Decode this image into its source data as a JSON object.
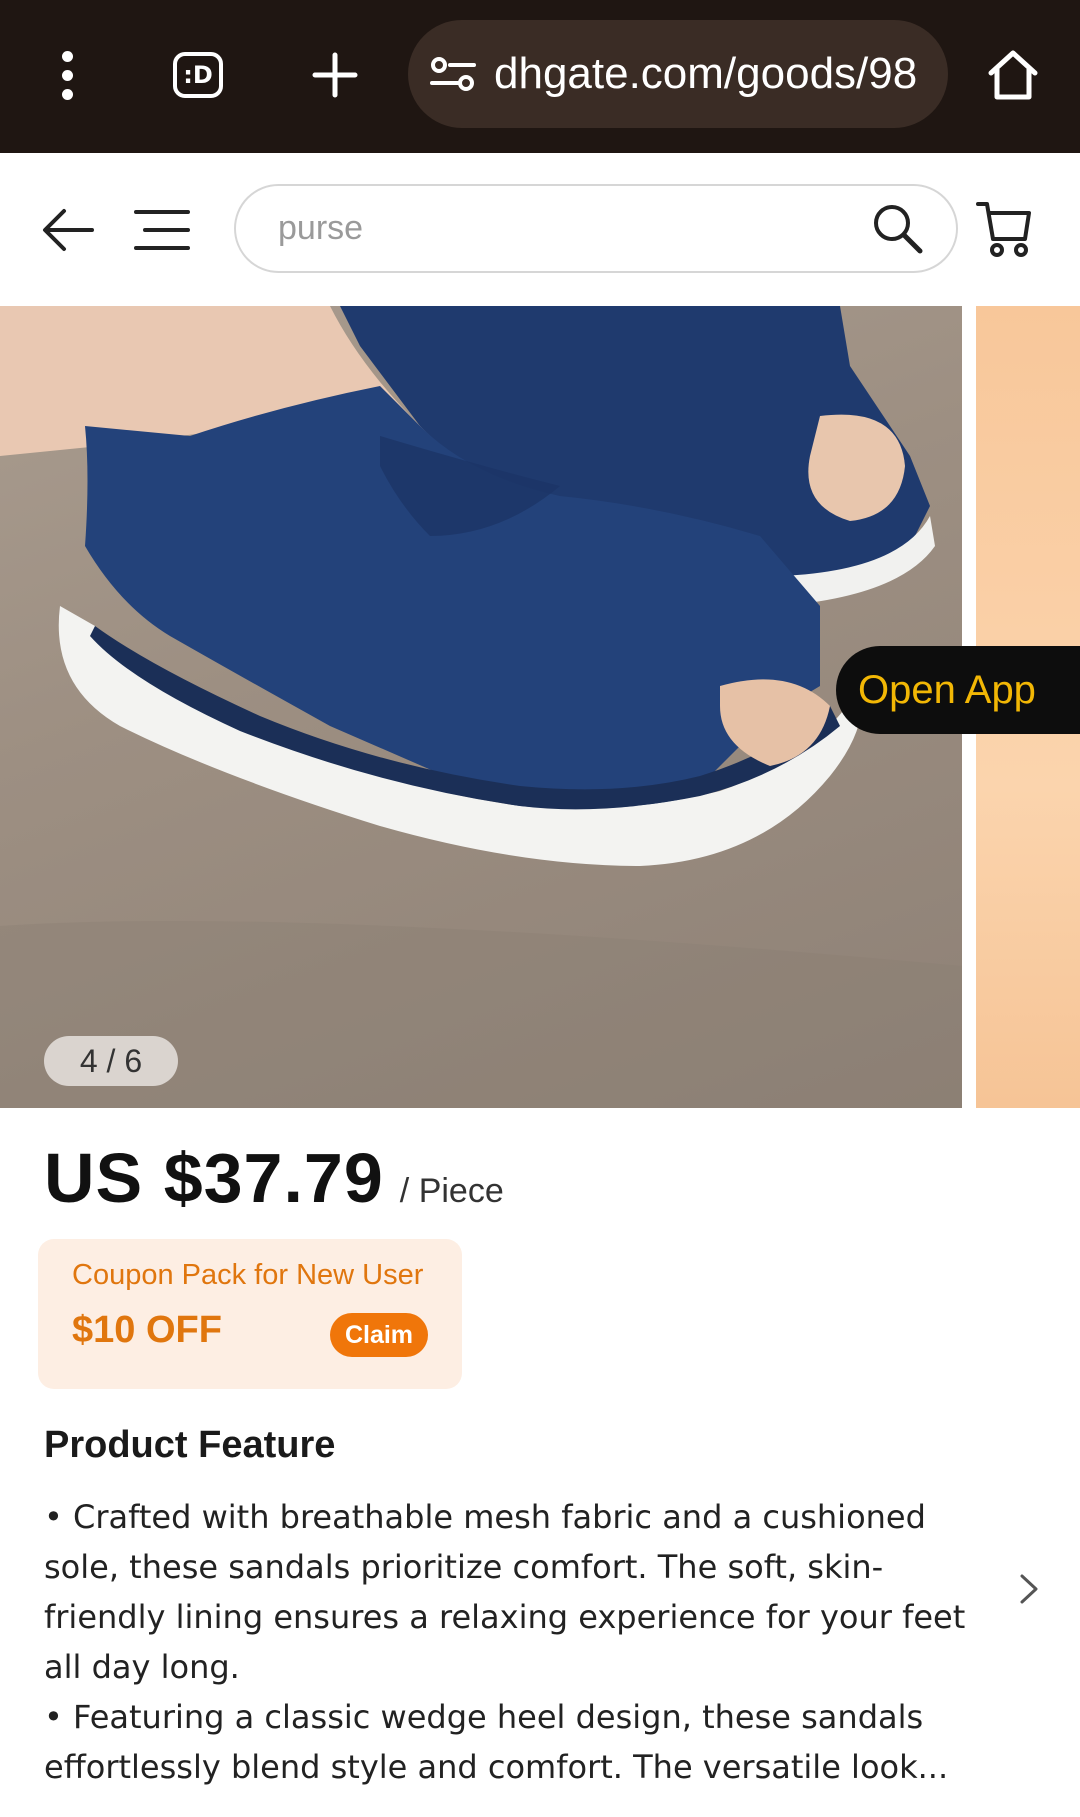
{
  "browser": {
    "url": "dhgate.com/goods/98",
    "tab_badge": ":D"
  },
  "header": {
    "search_placeholder": "purse"
  },
  "gallery": {
    "counter": "4 / 6",
    "open_app_label": "Open App"
  },
  "product": {
    "price": "US $37.79",
    "unit": "/ Piece"
  },
  "coupon": {
    "title": "Coupon Pack for New User",
    "amount": "$10 OFF",
    "claim_label": "Claim"
  },
  "feature": {
    "title": "Product Feature",
    "bullets": [
      "• Crafted with breathable mesh fabric and a cushioned sole, these sandals prioritize comfort. The soft, skin-friendly lining ensures a relaxing experience for your feet all day long.",
      "• Featuring a classic wedge heel design, these sandals effortlessly blend style and comfort. The versatile look..."
    ]
  },
  "colors": {
    "chrome_bg": "#1f1612",
    "accent_orange": "#f0760a",
    "open_app_text": "#f2b705",
    "sandal_blue": "#1f3a6e"
  }
}
